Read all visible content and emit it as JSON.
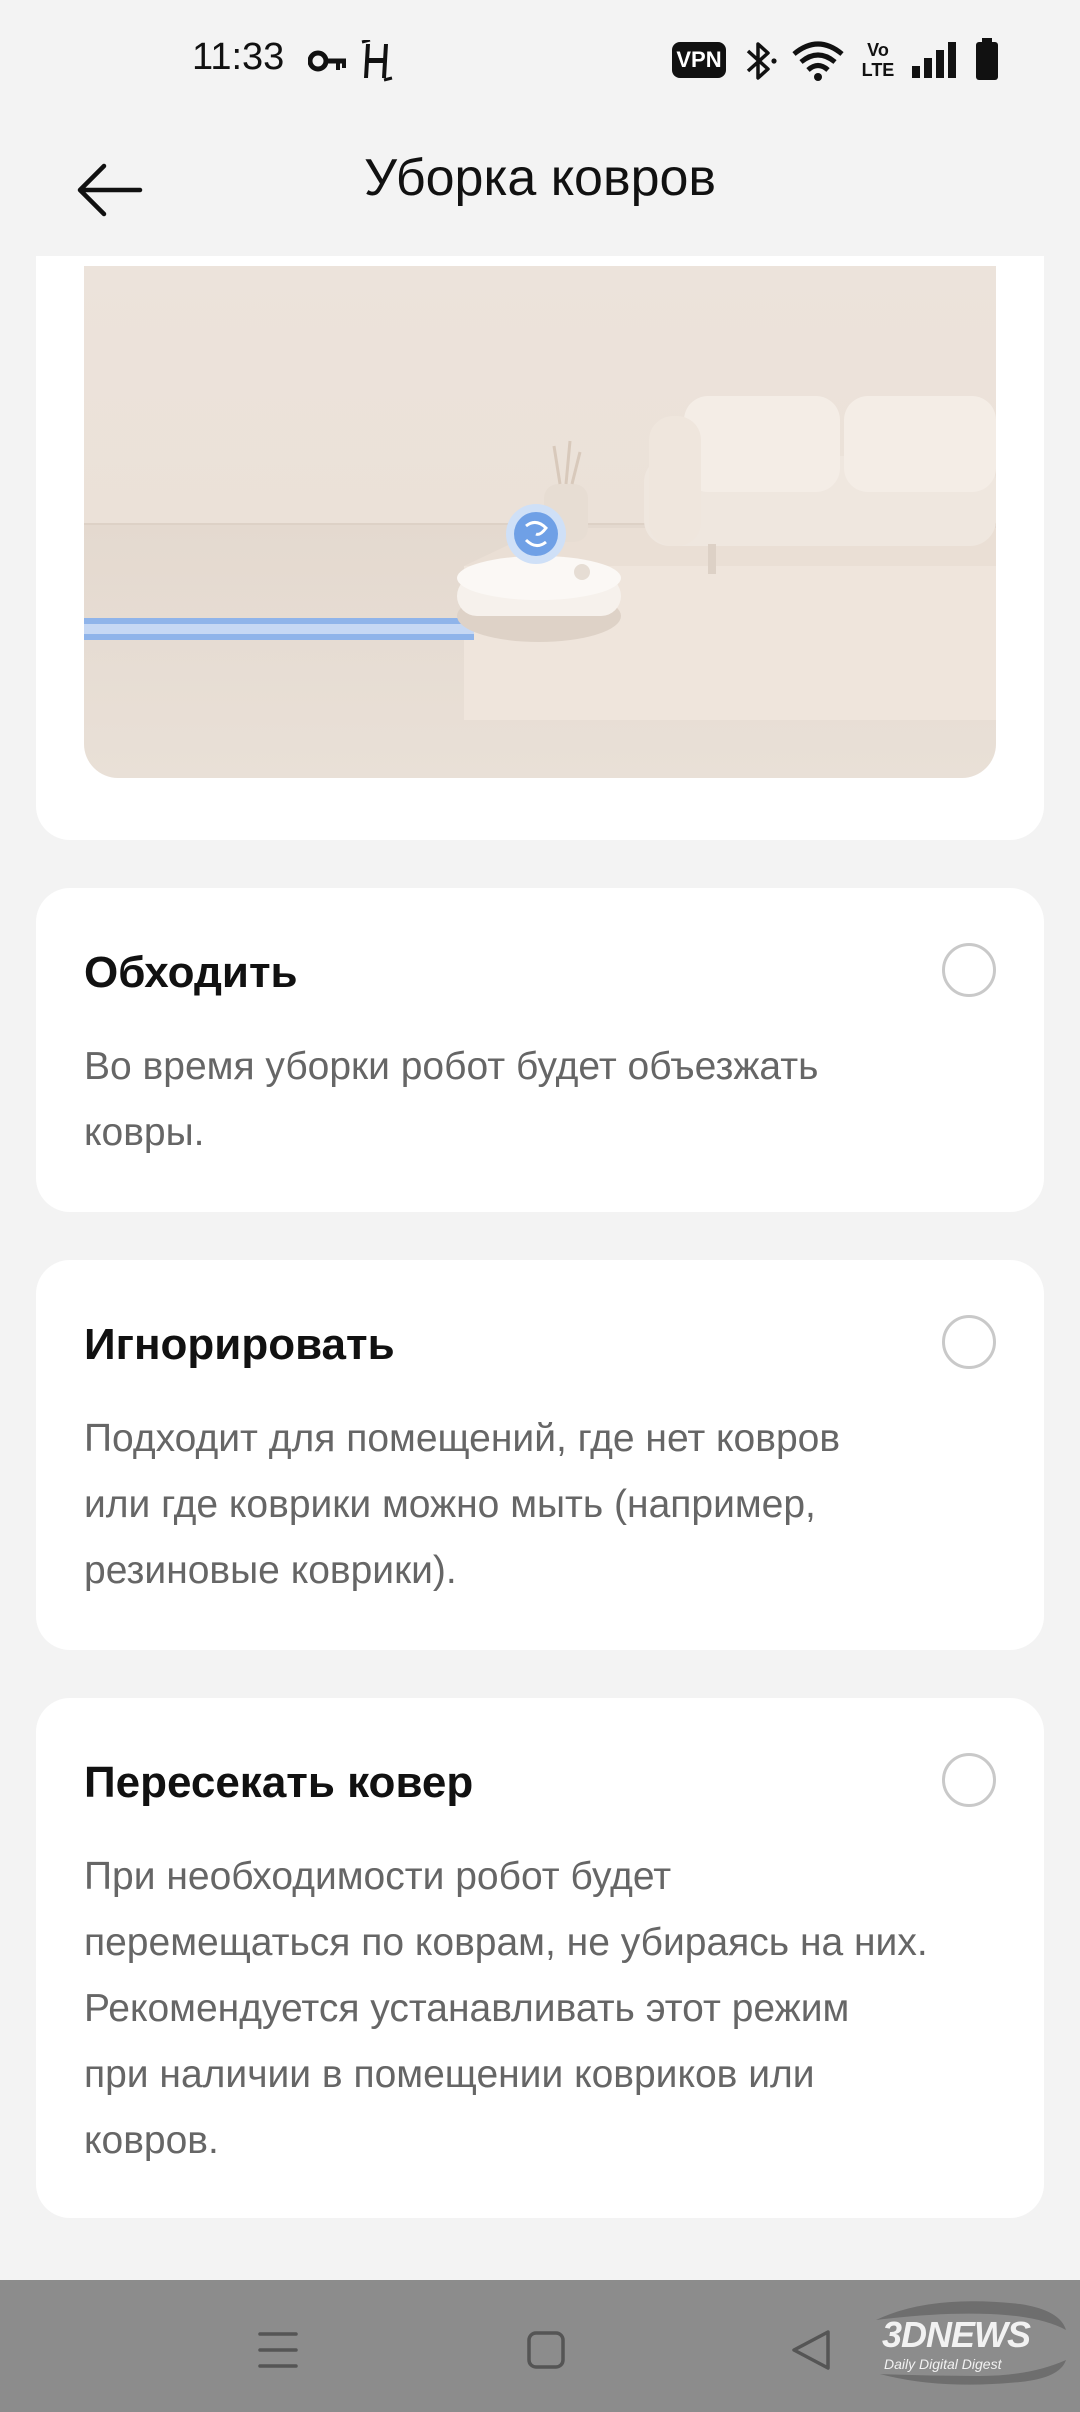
{
  "status_bar": {
    "time": "11:33",
    "vpn_label": "VPN",
    "volte_top": "Vo",
    "volte_bottom": "LTE",
    "icons": [
      "key-icon",
      "h-network-icon",
      "vpn-icon",
      "bluetooth-icon",
      "wifi-icon",
      "volte-icon",
      "signal-icon",
      "battery-icon"
    ]
  },
  "header": {
    "title": "Уборка ковров",
    "back_icon": "arrow-left-icon"
  },
  "hero": {
    "image": "robot-vacuum-carpet-illustration"
  },
  "options": [
    {
      "title": "Обходить",
      "description_lines": [
        "Во время уборки робот будет объезжать",
        "ковры."
      ],
      "selected": false
    },
    {
      "title": "Игнорировать",
      "description_lines": [
        "Подходит для помещений, где нет ковров",
        "или где коврики можно мыть (например,",
        "резиновые коврики)."
      ],
      "selected": false
    },
    {
      "title": "Пересекать ковер",
      "description_lines": [
        "При необходимости робот будет",
        "перемещаться по коврам, не убираясь на них.",
        "Рекомендуется устанавливать этот режим",
        "при наличии в помещении ковриков или",
        "ковров."
      ],
      "selected": false
    }
  ],
  "nav_bar": {
    "buttons": [
      "menu-icon",
      "home-icon",
      "back-triangle-icon"
    ]
  },
  "watermark": {
    "brand": "3DNEWS",
    "tagline": "Daily Digital Digest"
  },
  "colors": {
    "background": "#f3f3f3",
    "card": "#ffffff",
    "title_text": "#111111",
    "description_text": "#666666",
    "radio_border": "#c9c9c9",
    "nav_bar": "#8c8c8c",
    "accent_blue": "#8fb4ea"
  }
}
